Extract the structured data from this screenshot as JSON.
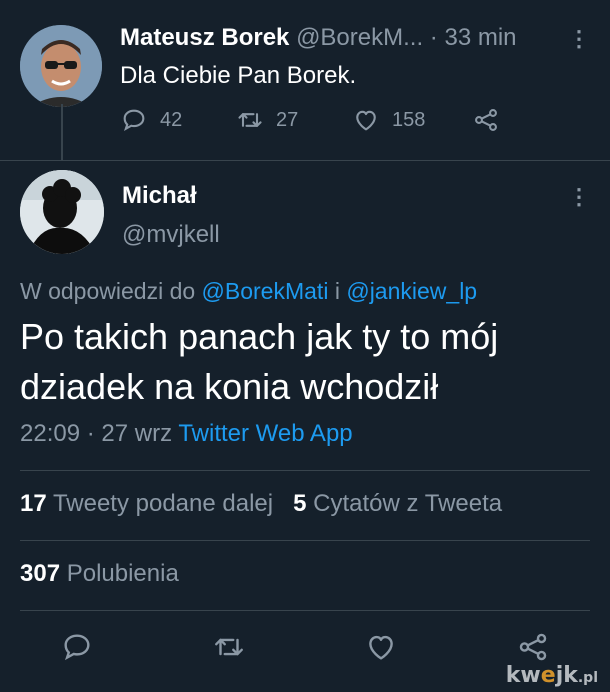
{
  "parent_tweet": {
    "author_name": "Mateusz Borek",
    "author_handle": "@BorekM...",
    "separator": "·",
    "time": "33 min",
    "text": "Dla Ciebie Pan Borek.",
    "reply_count": "42",
    "retweet_count": "27",
    "like_count": "158"
  },
  "reply_tweet": {
    "author_name": "Michał",
    "author_handle": "@mvjkell",
    "reply_to_prefix": "W odpowiedzi do",
    "reply_to_user1": "@BorekMati",
    "reply_to_conj": "i",
    "reply_to_user2": "@jankiew_lp",
    "text": "Po takich panach jak ty to mój dziadek na konia wchodził",
    "time": "22:09",
    "separator": "·",
    "date": "27 wrz",
    "source": "Twitter Web App",
    "retweets_count": "17",
    "retweets_label": "Tweety podane dalej",
    "quotes_count": "5",
    "quotes_label": "Cytatów z Tweeta",
    "likes_count": "307",
    "likes_label": "Polubienia"
  },
  "watermark": {
    "text_a": "kw",
    "text_e": "e",
    "text_b": "jk",
    "text_pl": ".pl"
  },
  "colors": {
    "background": "#15202b",
    "secondary_text": "#8b98a5",
    "link": "#1d9bf0",
    "divider": "#38444d"
  },
  "icons": {
    "reply": "comment-icon",
    "retweet": "retweet-icon",
    "like": "heart-icon",
    "share": "share-icon",
    "more": "more-dots-icon"
  }
}
